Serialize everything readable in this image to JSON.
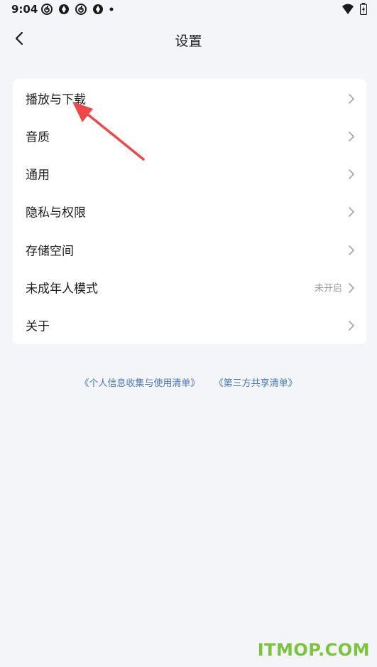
{
  "status_bar": {
    "time": "9:04",
    "left_icons": [
      "netease-music-icon",
      "aperture-icon",
      "netease-music-icon",
      "aperture-icon",
      "dot-icon"
    ],
    "right_icons": [
      "wifi-icon",
      "battery-icon"
    ]
  },
  "header": {
    "title": "设置",
    "back_icon": "chevron-left-icon"
  },
  "settings": {
    "items": [
      {
        "label": "播放与下载",
        "value": ""
      },
      {
        "label": "音质",
        "value": ""
      },
      {
        "label": "通用",
        "value": ""
      },
      {
        "label": "隐私与权限",
        "value": ""
      },
      {
        "label": "存储空间",
        "value": ""
      },
      {
        "label": "未成年人模式",
        "value": "未开启"
      },
      {
        "label": "关于",
        "value": ""
      }
    ]
  },
  "footer": {
    "link_personal_info": "《个人信息收集与使用清单》",
    "link_third_party": "《第三方共享清单》"
  },
  "watermark": "ITMOP.COM",
  "colors": {
    "background": "#f3f5f9",
    "card": "#ffffff",
    "link": "#4a78b5",
    "annotation_arrow": "#f04848",
    "watermark": "#7cc43b"
  }
}
